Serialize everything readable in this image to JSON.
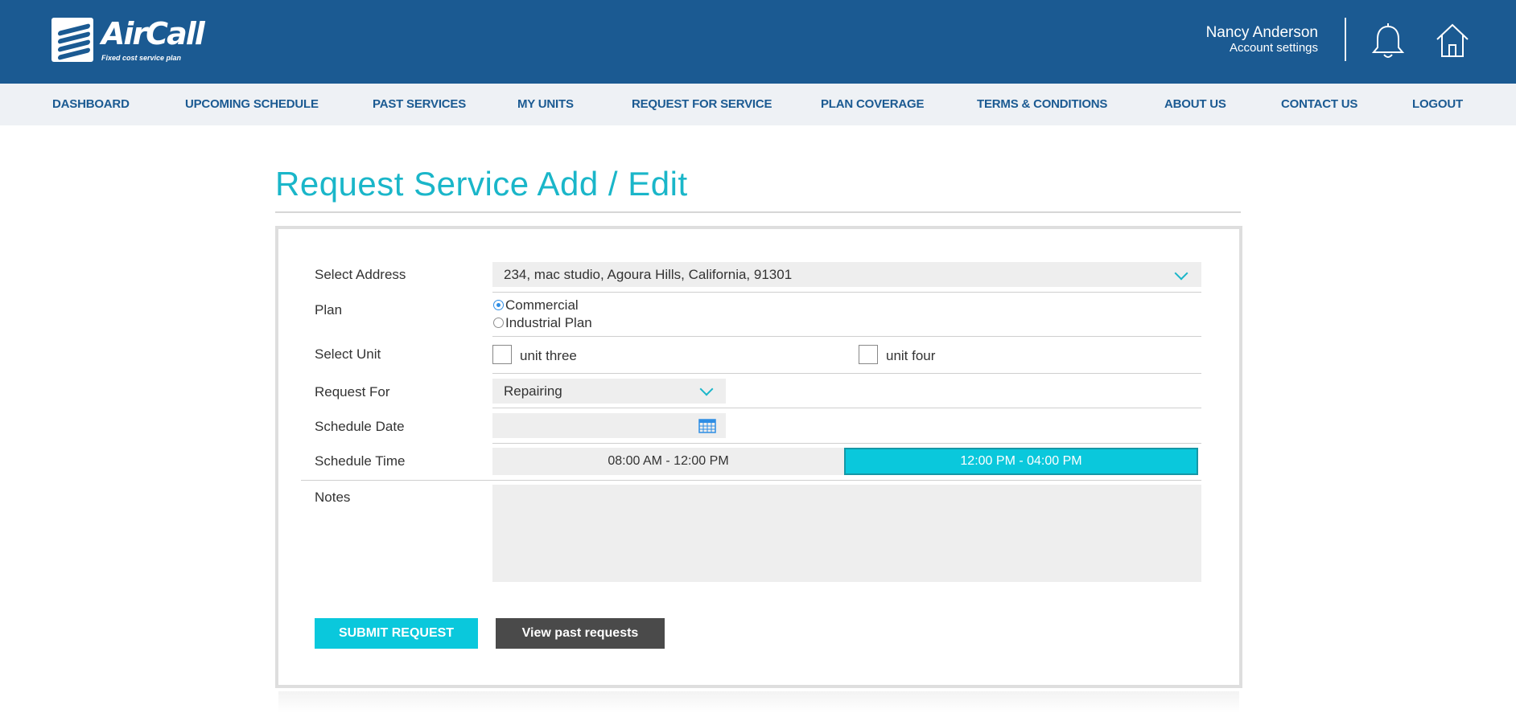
{
  "brand": {
    "name": "AirCall",
    "tagline": "Fixed cost service plan"
  },
  "user": {
    "name": "Nancy Anderson",
    "settings_link": "Account settings"
  },
  "icons": {
    "notifications": "bell-icon",
    "home": "home-icon",
    "calendar": "calendar-icon",
    "dropdown": "chevron-down-icon"
  },
  "colors": {
    "header_bg": "#1b5a92",
    "accent": "#1ab6c9",
    "nav_bg": "#eef1f5",
    "secondary_button": "#4a4a4a"
  },
  "nav": {
    "items": [
      {
        "label": "DASHBOARD"
      },
      {
        "label": "UPCOMING SCHEDULE"
      },
      {
        "label": "PAST SERVICES"
      },
      {
        "label": "MY UNITS"
      },
      {
        "label": "REQUEST FOR SERVICE"
      },
      {
        "label": "PLAN COVERAGE"
      },
      {
        "label": "TERMS & CONDITIONS"
      },
      {
        "label": "ABOUT US"
      },
      {
        "label": "CONTACT US"
      },
      {
        "label": "LOGOUT"
      }
    ]
  },
  "page": {
    "title": "Request Service Add / Edit"
  },
  "form": {
    "address": {
      "label": "Select Address",
      "value": "234, mac studio, Agoura Hills, California, 91301"
    },
    "plan": {
      "label": "Plan",
      "options": [
        {
          "label": "Commercial",
          "selected": true
        },
        {
          "label": "Industrial Plan",
          "selected": false
        }
      ]
    },
    "units": {
      "label": "Select Unit",
      "options": [
        {
          "label": "unit three",
          "checked": false
        },
        {
          "label": "unit four",
          "checked": false
        }
      ]
    },
    "request_for": {
      "label": "Request For",
      "value": "Repairing"
    },
    "schedule_date": {
      "label": "Schedule Date",
      "value": ""
    },
    "schedule_time": {
      "label": "Schedule Time",
      "slots": [
        {
          "label": "08:00 AM - 12:00 PM",
          "selected": false
        },
        {
          "label": "12:00 PM - 04:00 PM",
          "selected": true
        }
      ]
    },
    "notes": {
      "label": "Notes",
      "value": ""
    },
    "submit_label": "SUBMIT REQUEST",
    "past_label": "View past requests"
  }
}
